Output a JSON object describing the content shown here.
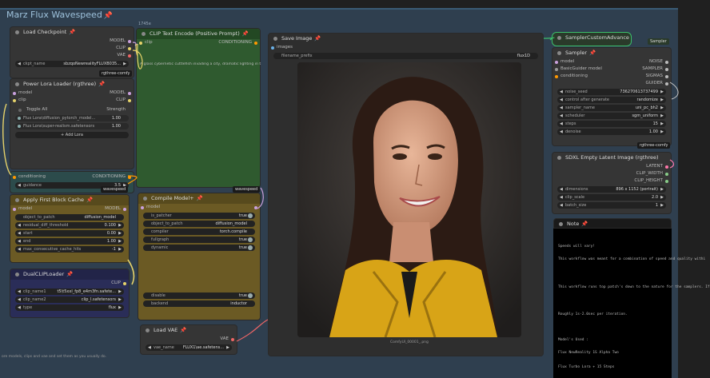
{
  "group": {
    "title": "Marz Flux Wavespeed"
  },
  "size_label": "1745e",
  "load_checkpoint": {
    "title": "Load Checkpoint",
    "outputs": [
      "MODEL",
      "CLIP",
      "VAE"
    ],
    "ckpt_label": "ckpt_name",
    "ckpt_value": "sbzqoNewrealityFLUXB035...",
    "badge": "rgthree-comfy"
  },
  "power_lora": {
    "title": "Power Lora Loader (rgthree)",
    "inputs": [
      "model",
      "clip"
    ],
    "outputs": [
      "MODEL",
      "CLIP"
    ],
    "toggle_all": "Toggle All",
    "strength_label": "Strength",
    "loras": [
      {
        "name": "Flux Lora\\diffusion_pytorch_model...",
        "strength": "1.00"
      },
      {
        "name": "Flux Lora\\super-realism.safetensors",
        "strength": "1.00"
      }
    ],
    "add_label": "+ Add Lora"
  },
  "guidance_node": {
    "input": "conditioning",
    "output": "CONDITIONING",
    "widget_label": "guidance",
    "widget_value": "3.5",
    "badge": "wavespeed"
  },
  "clip_encode": {
    "title": "CLIP Text Encode (Positive Prompt)",
    "input": "clip",
    "output": "CONDITIONING",
    "prompt": "A glass cybernetic cuttlefish invading a city, dramatic lighting in t",
    "badge": "wavespeed"
  },
  "save_image": {
    "title": "Save Image",
    "input": "images",
    "prefix_label": "filename_prefix",
    "prefix_value": "flux1D",
    "caption": "ComfyUI_00001_.png"
  },
  "sampler_custom": {
    "title": "SamplerCustomAdvance",
    "badge": "Sampler",
    "sampler_title": "Sampler",
    "inputs": [
      "model",
      "BasicGuider model",
      "conditioning"
    ],
    "outputs": [
      "NOISE",
      "SAMPLER",
      "SIGMAS",
      "GUIDER"
    ],
    "widgets": [
      {
        "label": "noise_seed",
        "value": "736270613737499"
      },
      {
        "label": "control after generate",
        "value": "randomize"
      },
      {
        "label": "sampler_name",
        "value": "uni_pc_bh2"
      },
      {
        "label": "scheduler",
        "value": "sgm_uniform"
      },
      {
        "label": "steps",
        "value": "15"
      },
      {
        "label": "denoise",
        "value": "1.00"
      }
    ],
    "footer_badge": "rgthree-comfy"
  },
  "sdxl_latent": {
    "title": "SDXL Empty Latent Image (rgthree)",
    "outputs": [
      "LATENT",
      "CLIP_WIDTH",
      "CLIP_HEIGHT"
    ],
    "widgets": [
      {
        "label": "dimensions",
        "value": "896 x 1152 (portrait)"
      },
      {
        "label": "clip_scale",
        "value": "2.0"
      },
      {
        "label": "batch_size",
        "value": "1"
      }
    ]
  },
  "first_block": {
    "title": "Apply First Block Cache",
    "input": "model",
    "output": "MODEL",
    "widgets": [
      {
        "label": "object_to_patch",
        "value": "diffusion_model"
      },
      {
        "label": "residual_diff_threshold",
        "value": "0.100"
      },
      {
        "label": "start",
        "value": "0.00"
      },
      {
        "label": "end",
        "value": "1.00"
      },
      {
        "label": "max_consecutive_cache_hits",
        "value": "-1"
      }
    ]
  },
  "compile_model": {
    "title": "Compile Model+",
    "input": "model",
    "widgets": [
      {
        "label": "is_patcher",
        "value": "true"
      },
      {
        "label": "object_to_patch",
        "value": "diffusion_model"
      },
      {
        "label": "compiler",
        "value": "torch.compile"
      },
      {
        "label": "fullgraph",
        "value": "true"
      },
      {
        "label": "dynamic",
        "value": "true"
      }
    ],
    "widgets2": [
      {
        "label": "disable",
        "value": "true"
      },
      {
        "label": "backend",
        "value": "inductor"
      }
    ]
  },
  "dual_clip": {
    "title": "DualCLIPLoader",
    "output": "CLIP",
    "widgets": [
      {
        "label": "clip_name1",
        "value": "t5\\t5xxl_fp8_e4m3fn.safete..."
      },
      {
        "label": "clip_name2",
        "value": "clip_l.safetensors"
      },
      {
        "label": "type",
        "value": "flux"
      }
    ]
  },
  "load_vae": {
    "title": "Load VAE",
    "output": "VAE",
    "widget_label": "vae_name",
    "widget_value": "FLUX1\\ae.safetens..."
  },
  "note": {
    "title": "Note",
    "lines": [
      "Speeds will vary!",
      "This workflow was meant for a combination of speed and quality withi",
      "This workflow runs top patch's down to the nature for the samplers. If",
      "Roughly 1s-2.0sec per iteration.",
      "Model's Used :",
      "Flux NewReality 1S Alpha Two",
      "Flux Turbo Lora + 15 Steps"
    ]
  },
  "bottom_hint": "ore models, clips and vae and set them as you usually do."
}
